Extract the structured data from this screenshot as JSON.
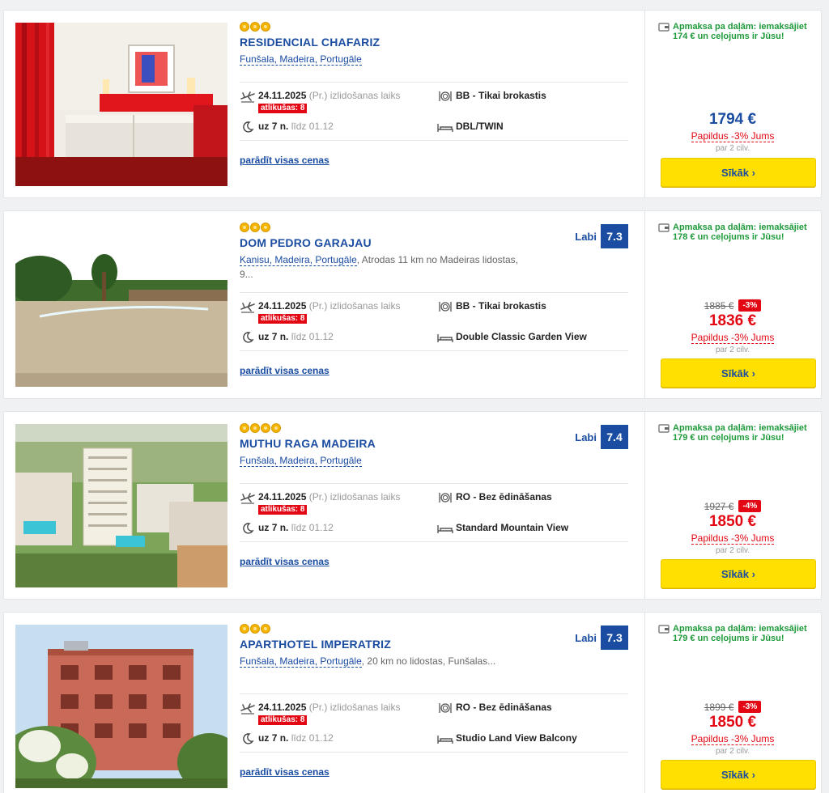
{
  "labels": {
    "departure_suffix": "izlidošanas laiks",
    "remaining_prefix": "atlikušas:",
    "nights_prefix": "uz",
    "nights_suffix": "n.",
    "until": "līdz",
    "show_all_prices": "parādīt visas cenas",
    "pay_note": "Apmaksa pa daļām: iemaksājiet",
    "extra_discount": "Papildus -3% Jums",
    "per_people": "par 2 cilv.",
    "more_button": "Sīkāk ›"
  },
  "colors": {
    "brand_blue": "#1a4ca1",
    "sale_red": "#e30613",
    "cta_yellow": "#ffe000",
    "pay_green": "#1e9a3b"
  },
  "hotels": [
    {
      "name": "RESIDENCIAL CHAFARIZ",
      "stars": 3,
      "location": "Funšala, Madeira, Portugāle",
      "location_extra": "",
      "rating_word": "",
      "rating_score": "",
      "date": "24.11.2025",
      "weekday": "(Pr.)",
      "remaining": "8",
      "nights": "7",
      "until_date": "01.12",
      "board": "BB - Tikai brokastis",
      "room": "DBL/TWIN",
      "pay_note_line2": "174 € un ceļojums ir Jūsu!",
      "old_price": "",
      "discount": "",
      "price": "1794 €",
      "price_color": "#1a4ca1",
      "image": "bedroom"
    },
    {
      "name": "DOM PEDRO GARAJAU",
      "stars": 3,
      "location": "Kanisu, Madeira, Portugāle",
      "location_extra": ", Atrodas 11 km no Madeiras lidostas, 9...",
      "rating_word": "Labi",
      "rating_score": "7.3",
      "date": "24.11.2025",
      "weekday": "(Pr.)",
      "remaining": "8",
      "nights": "7",
      "until_date": "01.12",
      "board": "BB - Tikai brokastis",
      "room": "Double Classic Garden View",
      "pay_note_line2": "178 € un ceļojums ir Jūsu!",
      "old_price": "1885 €",
      "discount": "-3%",
      "price": "1836 €",
      "price_color": "#e30613",
      "image": "pool"
    },
    {
      "name": "MUTHU RAGA MADEIRA",
      "stars": 4,
      "location": "Funšala, Madeira, Portugāle",
      "location_extra": "",
      "rating_word": "Labi",
      "rating_score": "7.4",
      "date": "24.11.2025",
      "weekday": "(Pr.)",
      "remaining": "8",
      "nights": "7",
      "until_date": "01.12",
      "board": "RO - Bez ēdināšanas",
      "room": "Standard Mountain View",
      "pay_note_line2": "179 € un ceļojums ir Jūsu!",
      "old_price": "1927 €",
      "discount": "-4%",
      "price": "1850 €",
      "price_color": "#e30613",
      "image": "tower"
    },
    {
      "name": "APARTHOTEL IMPERATRIZ",
      "stars": 3,
      "location": "Funšala, Madeira, Portugāle",
      "location_extra": ", 20 km no lidostas, Funšalas...",
      "rating_word": "Labi",
      "rating_score": "7.3",
      "date": "24.11.2025",
      "weekday": "(Pr.)",
      "remaining": "8",
      "nights": "7",
      "until_date": "01.12",
      "board": "RO - Bez ēdināšanas",
      "room": "Studio Land View Balcony",
      "pay_note_line2": "179 € un ceļojums ir Jūsu!",
      "old_price": "1899 €",
      "discount": "-3%",
      "price": "1850 €",
      "price_color": "#e30613",
      "image": "building"
    }
  ]
}
